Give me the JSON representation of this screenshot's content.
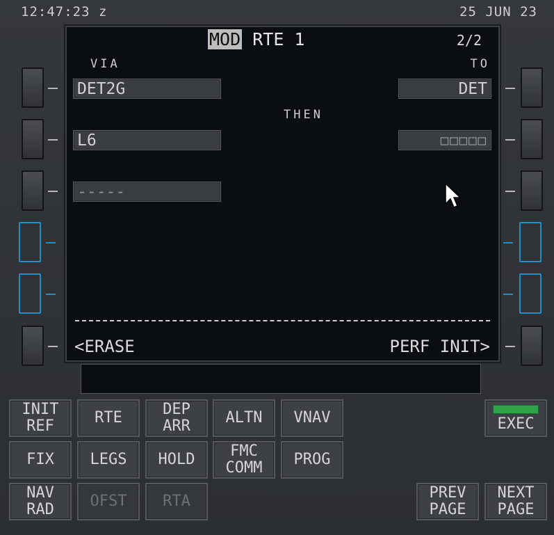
{
  "header": {
    "clock": "12:47:23 z",
    "date": "25 JUN 23"
  },
  "screen": {
    "title_flag": "MOD",
    "title": "RTE 1",
    "page": "2/2",
    "via_label": "VIA",
    "to_label": "TO",
    "then_label": "THEN",
    "rows": [
      {
        "via": "DET2G",
        "to": "DET"
      },
      {
        "via": "L6",
        "to": "□□□□□"
      },
      {
        "via": "-----"
      }
    ],
    "left_bottom": "<ERASE",
    "right_bottom": "PERF INIT>"
  },
  "scratchpad": "",
  "keys": {
    "init_ref": "INIT\nREF",
    "rte": "RTE",
    "dep_arr": "DEP\nARR",
    "altn": "ALTN",
    "vnav": "VNAV",
    "fix": "FIX",
    "legs": "LEGS",
    "hold": "HOLD",
    "fmc_comm": "FMC\nCOMM",
    "prog": "PROG",
    "nav_rad": "NAV\nRAD",
    "ofst": "OFST",
    "rta": "RTA",
    "exec": "EXEC",
    "prev_page": "PREV\nPAGE",
    "next_page": "NEXT\nPAGE"
  },
  "colors": {
    "active_lsk": "#1f8fc8",
    "exec_light": "#2fa44a"
  }
}
